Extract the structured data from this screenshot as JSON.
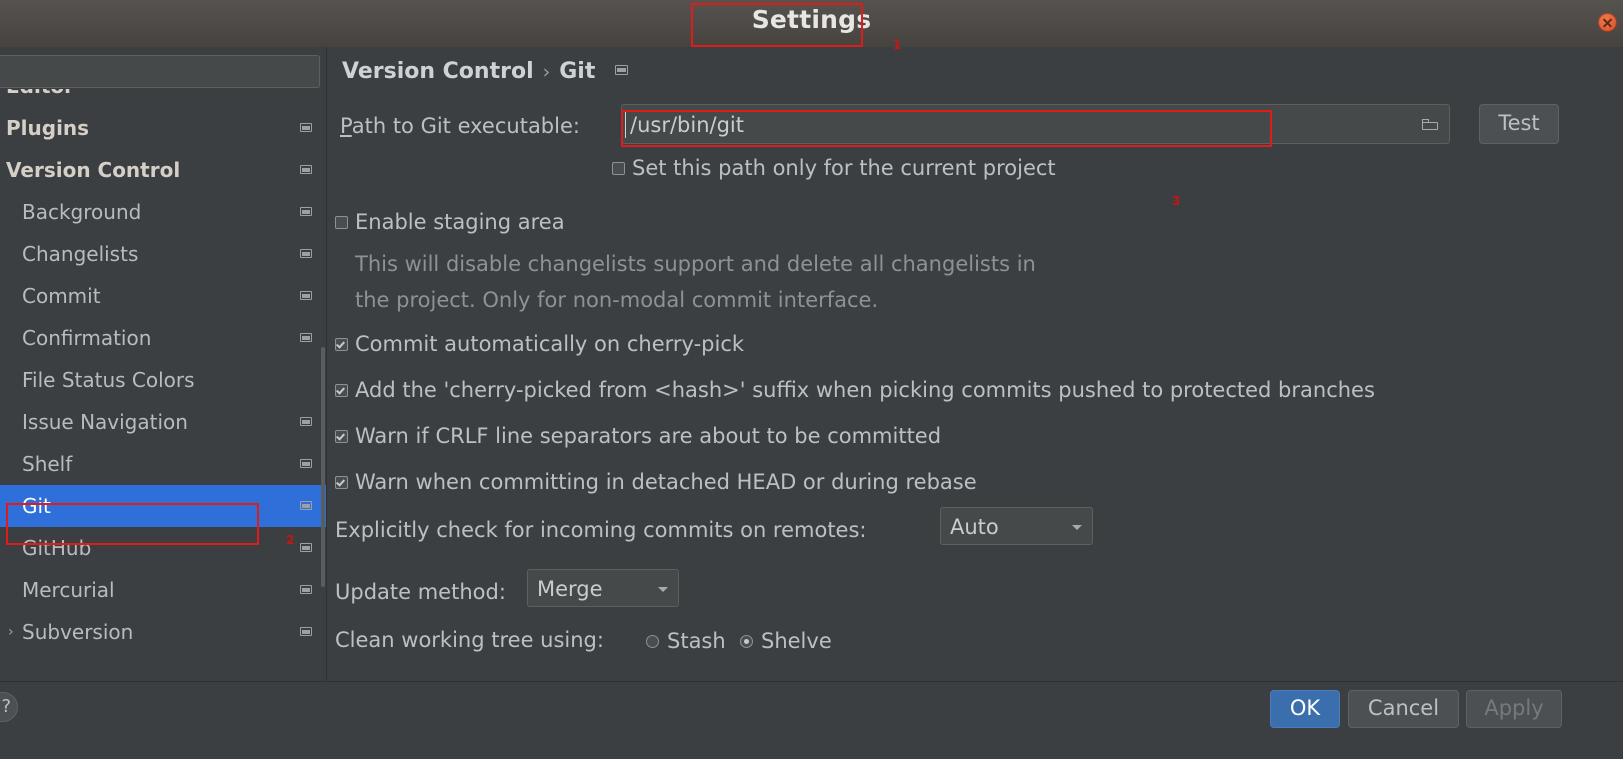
{
  "window": {
    "title": "Settings",
    "close_icon": "close-icon"
  },
  "sidebar": {
    "search": {
      "value": "",
      "placeholder": "",
      "icon": "search-icon"
    },
    "items": [
      {
        "label": "Editor",
        "level": 0,
        "bold": true,
        "badge": false,
        "arrow": "",
        "selected": false,
        "clip": "top"
      },
      {
        "label": "Plugins",
        "level": 0,
        "bold": true,
        "badge": true,
        "arrow": "",
        "selected": false,
        "clip": ""
      },
      {
        "label": "Version Control",
        "level": 0,
        "bold": true,
        "badge": true,
        "arrow": "",
        "selected": false,
        "clip": ""
      },
      {
        "label": "Background",
        "level": 1,
        "bold": false,
        "badge": true,
        "arrow": "",
        "selected": false,
        "clip": ""
      },
      {
        "label": "Changelists",
        "level": 1,
        "bold": false,
        "badge": true,
        "arrow": "",
        "selected": false,
        "clip": ""
      },
      {
        "label": "Commit",
        "level": 1,
        "bold": false,
        "badge": true,
        "arrow": "",
        "selected": false,
        "clip": ""
      },
      {
        "label": "Confirmation",
        "level": 1,
        "bold": false,
        "badge": true,
        "arrow": "",
        "selected": false,
        "clip": ""
      },
      {
        "label": "File Status Colors",
        "level": 1,
        "bold": false,
        "badge": false,
        "arrow": "",
        "selected": false,
        "clip": ""
      },
      {
        "label": "Issue Navigation",
        "level": 1,
        "bold": false,
        "badge": true,
        "arrow": "",
        "selected": false,
        "clip": ""
      },
      {
        "label": "Shelf",
        "level": 1,
        "bold": false,
        "badge": true,
        "arrow": "",
        "selected": false,
        "clip": ""
      },
      {
        "label": "Git",
        "level": 1,
        "bold": false,
        "badge": true,
        "arrow": "",
        "selected": true,
        "clip": ""
      },
      {
        "label": "GitHub",
        "level": 1,
        "bold": false,
        "badge": true,
        "arrow": "",
        "selected": false,
        "clip": ""
      },
      {
        "label": "Mercurial",
        "level": 1,
        "bold": false,
        "badge": true,
        "arrow": "",
        "selected": false,
        "clip": ""
      },
      {
        "label": "Subversion",
        "level": 1,
        "bold": false,
        "badge": true,
        "arrow": "›",
        "selected": false,
        "clip": "bottom"
      }
    ]
  },
  "content": {
    "breadcrumb": {
      "parent": "Version Control",
      "separator": "›",
      "current": "Git"
    },
    "path_row": {
      "label_prefix": "",
      "label_mnemonic": "P",
      "label_rest": "ath to Git executable:",
      "value": "/usr/bin/git",
      "browse_icon": "folder-icon",
      "test_label": "Test"
    },
    "set_path_current_project": {
      "label": "Set this path only for the current project",
      "checked": false
    },
    "enable_staging": {
      "label": "Enable staging area",
      "checked": false,
      "description_line1": "This will disable changelists support and delete all changelists in",
      "description_line2": "the project. Only for non-modal commit interface."
    },
    "checkboxes": [
      {
        "label": "Commit automatically on cherry-pick",
        "checked": true
      },
      {
        "label": "Add the 'cherry-picked from <hash>' suffix when picking commits pushed to protected branches",
        "checked": true
      },
      {
        "label": "Warn if CRLF line separators are about to be committed",
        "checked": true
      },
      {
        "label": "Warn when committing in detached HEAD or during rebase",
        "checked": true
      }
    ],
    "incoming_commits": {
      "label": "Explicitly check for incoming commits on remotes:",
      "value": "Auto"
    },
    "update_method": {
      "label": "Update method:",
      "value": "Merge"
    },
    "clean_working_tree": {
      "label": "Clean working tree using:",
      "option_stash": "Stash",
      "option_shelve": "Shelve",
      "selected": "Shelve"
    }
  },
  "footer": {
    "help_label": "?",
    "ok_label": "OK",
    "cancel_label": "Cancel",
    "apply_label": "Apply"
  },
  "annotations": [
    {
      "num": "1"
    },
    {
      "num": "2"
    },
    {
      "num": "3"
    }
  ],
  "colors": {
    "accent": "#2f6fd9",
    "annotation": "#e01b1b",
    "primary_button": "#3b6ead"
  }
}
